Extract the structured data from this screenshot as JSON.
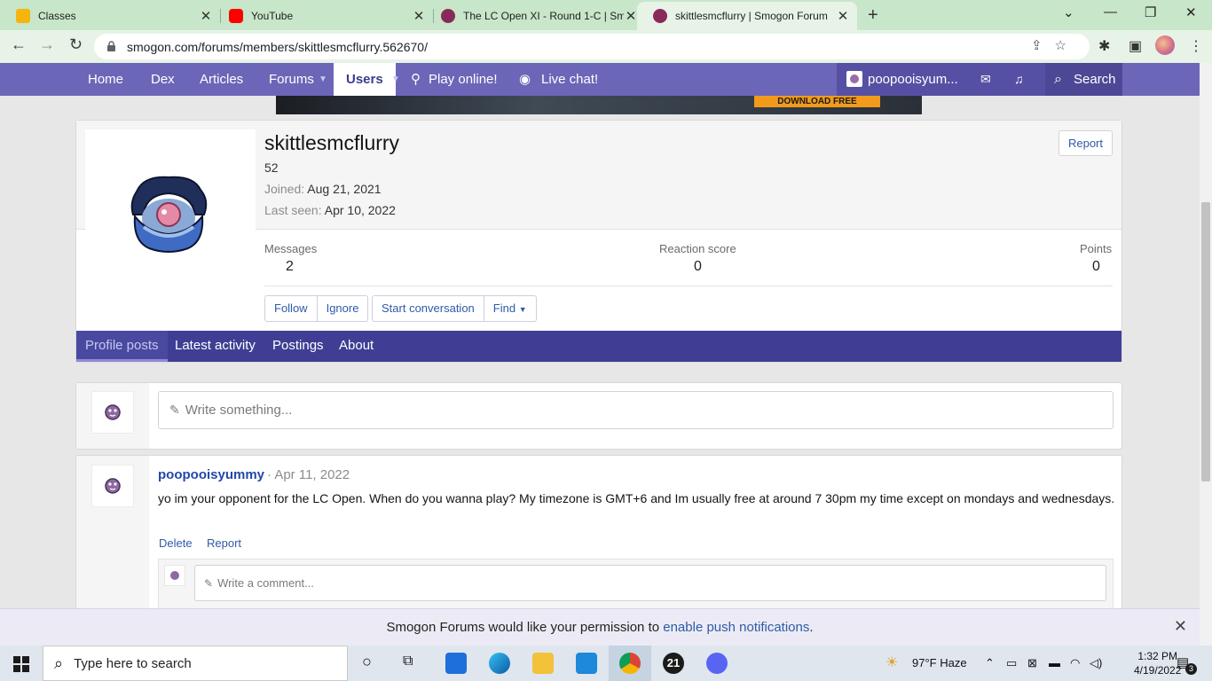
{
  "browser": {
    "tabs": [
      {
        "title": "Classes",
        "icon": "google-classroom-icon",
        "color": "#f6b40e"
      },
      {
        "title": "YouTube",
        "icon": "youtube-icon",
        "color": "#ff0000"
      },
      {
        "title": "The LC Open XI - Round 1-C | Sm",
        "icon": "smogon-icon",
        "color": "#8a2a5a"
      },
      {
        "title": "skittlesmcflurry | Smogon Forum",
        "icon": "smogon-icon",
        "color": "#8a2a5a"
      }
    ],
    "active_tab": 3,
    "url": "smogon.com/forums/members/skittlesmcflurry.562670/"
  },
  "site_nav": {
    "items": [
      "Home",
      "Dex",
      "Articles",
      "Forums",
      "Users",
      "Play online!",
      "Live chat!"
    ],
    "account_name": "poopooisyum...",
    "search_label": "Search"
  },
  "banner": {
    "button_text": "DOWNLOAD FREE"
  },
  "profile": {
    "username": "skittlesmcflurry",
    "title_line": "52",
    "joined_label": "Joined:",
    "joined_value": "Aug 21, 2021",
    "last_seen_label": "Last seen:",
    "last_seen_value": "Apr 10, 2022",
    "report_label": "Report",
    "stats": [
      {
        "label": "Messages",
        "value": "2"
      },
      {
        "label": "Reaction score",
        "value": "0"
      },
      {
        "label": "Points",
        "value": "0"
      }
    ],
    "actions": [
      "Follow",
      "Ignore",
      "Start conversation",
      "Find"
    ],
    "tabs": [
      "Profile posts",
      "Latest activity",
      "Postings",
      "About"
    ],
    "selected_tab": "Profile posts"
  },
  "composer": {
    "placeholder": "Write something..."
  },
  "post": {
    "author": "poopooisyummy",
    "date": "· Apr 11, 2022",
    "text": "yo im your opponent for the LC Open. When do you wanna play? My timezone is GMT+6 and Im usually free at around 7 30pm my time except on mondays and wednesdays.",
    "actions": [
      "Delete",
      "Report"
    ],
    "comment_placeholder": "Write a comment..."
  },
  "push_bar": {
    "text_before": "Smogon Forums would like your permission to ",
    "link_text": "enable push notifications",
    "text_after": "."
  },
  "taskbar": {
    "search_placeholder": "Type here to search",
    "weather": "97°F  Haze",
    "time": "1:32 PM",
    "date": "4/19/2022",
    "notification_count": "3",
    "badge_21": "21"
  },
  "colors": {
    "site_nav": "#6c66b8",
    "profile_tabs": "#3f3e94",
    "link": "#2f5ba8",
    "chrome_frame": "#c8e6c9"
  }
}
